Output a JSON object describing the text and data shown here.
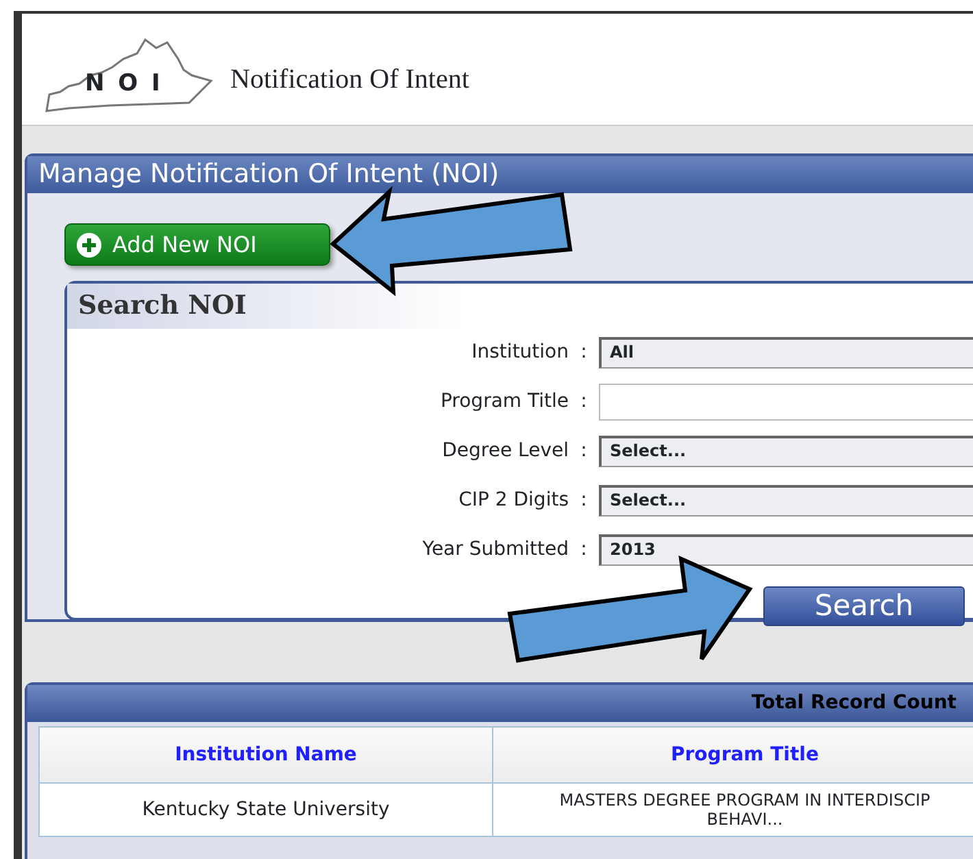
{
  "header": {
    "logo_text": "N O I",
    "title": "Notification Of Intent"
  },
  "panel": {
    "title": "Manage Notification Of Intent (NOI)",
    "add_button": "Add New NOI"
  },
  "search": {
    "title": "Search NOI",
    "fields": [
      {
        "label": "Institution",
        "separator": ":",
        "kind": "select",
        "value": "All"
      },
      {
        "label": "Program Title",
        "separator": ":",
        "kind": "text"
      },
      {
        "label": "Degree Level",
        "separator": ":",
        "kind": "select",
        "value": "Select..."
      },
      {
        "label": "CIP 2 Digits",
        "separator": ":",
        "kind": "select",
        "value": "Select..."
      },
      {
        "label": "Year Submitted",
        "separator": ":",
        "kind": "select",
        "value": "2013"
      }
    ],
    "button": "Search"
  },
  "results": {
    "record_count_label": "Total Record Count",
    "columns": [
      "Institution Name",
      "Program Title"
    ],
    "rows": [
      {
        "cells": [
          [
            "Kentucky State University"
          ],
          [
            "MASTERS DEGREE PROGRAM IN INTERDISCIP",
            "BEHAVI..."
          ]
        ]
      }
    ]
  }
}
